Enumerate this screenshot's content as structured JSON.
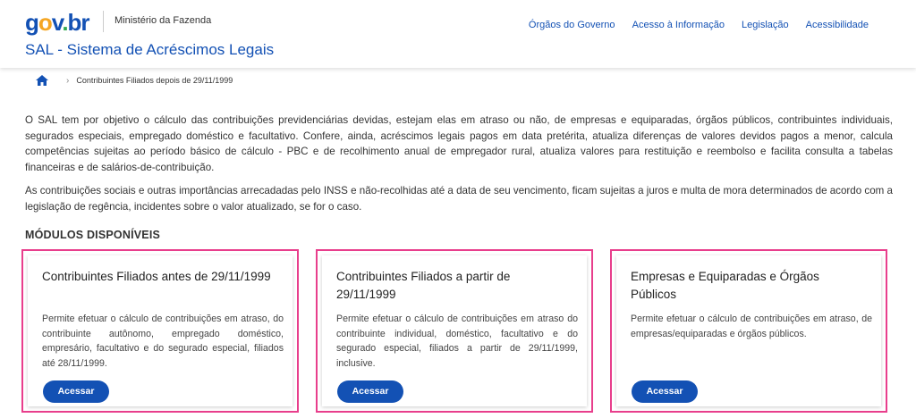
{
  "header": {
    "logo": {
      "g": "g",
      "o": "o",
      "v": "v",
      "dot": ".",
      "br": "br"
    },
    "ministry": "Ministério da Fazenda",
    "system_title": "SAL - Sistema de Acréscimos Legais",
    "nav": [
      "Órgãos do Governo",
      "Acesso à Informação",
      "Legislação",
      "Acessibilidade"
    ]
  },
  "breadcrumb": {
    "current": "Contribuintes Filiados depois de 29/11/1999"
  },
  "intro": {
    "p1": "O SAL tem por objetivo o cálculo das contribuições previdenciárias devidas, estejam elas em atraso ou não, de empresas e equiparadas, órgãos públicos, contribuintes individuais, segurados especiais, empregado doméstico e facultativo. Confere, ainda, acréscimos legais pagos em data pretérita, atualiza diferenças de valores devidos pagos a menor, calcula competências sujeitas ao período básico de cálculo - PBC e de recolhimento anual de empregador rural, atualiza valores para restituição e reembolso e facilita consulta a tabelas financeiras e de salários-de-contribuição.",
    "p2": "As contribuições sociais e outras importâncias arrecadadas pelo INSS e não-recolhidas até a data de seu vencimento, ficam sujeitas a juros e multa de mora determinados de acordo com a legislação de regência, incidentes sobre o valor atualizado, se for o caso."
  },
  "modules": {
    "title": "MÓDULOS DISPONÍVEIS",
    "cards": [
      {
        "title": "Contribuintes Filiados antes de 29/11/1999",
        "text": "Permite efetuar o cálculo de contribuições em atraso, do contribuinte autônomo, empregado doméstico, empresário, facultativo e do segurado especial, filiados até 28/11/1999.",
        "button": "Acessar"
      },
      {
        "title": "Contribuintes Filiados a partir de 29/11/1999",
        "text": "Permite efetuar o cálculo de contribuições em atraso do contribuinte individual, doméstico, facultativo e do segurado especial, filiados a partir de 29/11/1999, inclusive.",
        "button": "Acessar"
      },
      {
        "title": "Empresas e Equiparadas e Órgãos Públicos",
        "text": "Permite efetuar o cálculo de contribuições em atraso, de empresas/equiparadas e órgãos públicos.",
        "button": "Acessar"
      }
    ]
  },
  "colors": {
    "brand_blue": "#1351b4",
    "highlight_pink": "#e83e8c",
    "logo_yellow": "#f5a623",
    "logo_green": "#2fa84f"
  }
}
